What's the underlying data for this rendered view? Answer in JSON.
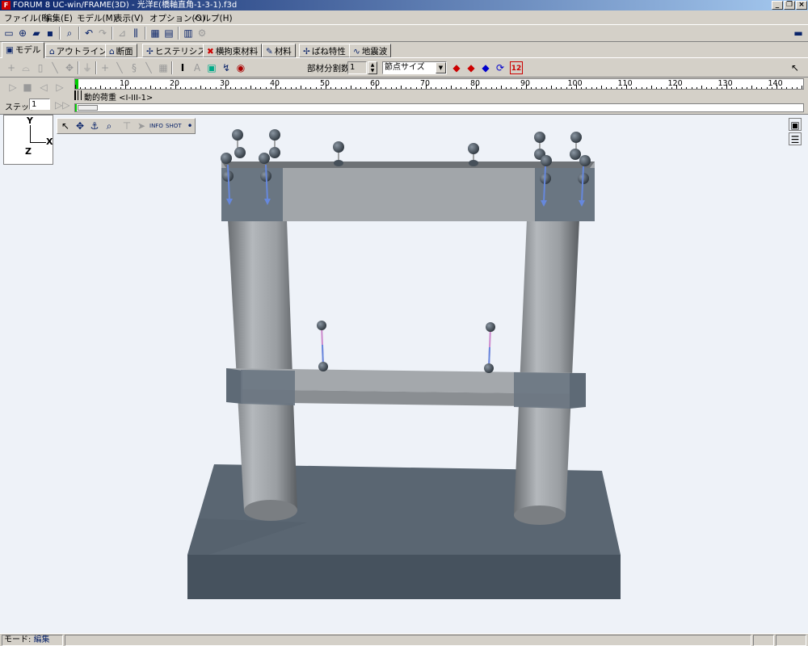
{
  "window": {
    "title": "FORUM 8  UC-win/FRAME(3D) - 光洋E(橋軸直角-1-3-1).f3d",
    "minimize": "_",
    "restore": "❐",
    "close": "×"
  },
  "menu": [
    {
      "label": "ファイル(F)"
    },
    {
      "label": "編集(E)"
    },
    {
      "label": "モデル(M)"
    },
    {
      "label": "表示(V)"
    },
    {
      "label": "オプション(O)"
    },
    {
      "label": "ヘルプ(H)"
    }
  ],
  "tabs": [
    {
      "label": "モデル",
      "icon": "model-icon",
      "active": true
    },
    {
      "label": "アウトライン",
      "icon": "outline-icon"
    },
    {
      "label": "断面",
      "icon": "section-icon"
    },
    {
      "label": "ヒステリシス",
      "icon": "hysteresis-icon"
    },
    {
      "label": "横拘束材料",
      "icon": "constraint-icon"
    },
    {
      "label": "材料",
      "icon": "material-icon"
    },
    {
      "label": "ばね特性",
      "icon": "spring-icon"
    },
    {
      "label": "地震波",
      "icon": "wave-icon"
    }
  ],
  "toolbar2": {
    "segment_label": "部材分割数",
    "segment_value": "1",
    "dropdown_value": "節点サイズ"
  },
  "timeline": {
    "ruler_ticks": [
      "10",
      "20",
      "30",
      "40",
      "50",
      "60",
      "70",
      "80",
      "90",
      "100",
      "110",
      "120",
      "130",
      "140"
    ],
    "track_label": "動的荷重 <I-III-1>",
    "step_label": "ステップ:",
    "step_value": "1"
  },
  "axes": {
    "y": "Y",
    "x": "X",
    "z": "Z"
  },
  "status": {
    "mode_label": "モード:",
    "mode_value": "編集"
  },
  "colors": {
    "title_start": "#0a246a",
    "title_end": "#a6caf0",
    "viewport_bg": "#eef2f8",
    "beam": "#a0a4a8",
    "footing": "#4a5866",
    "node": "#46505a",
    "load_arrow": "#6688dd",
    "spring_line": "#cc88cc"
  }
}
